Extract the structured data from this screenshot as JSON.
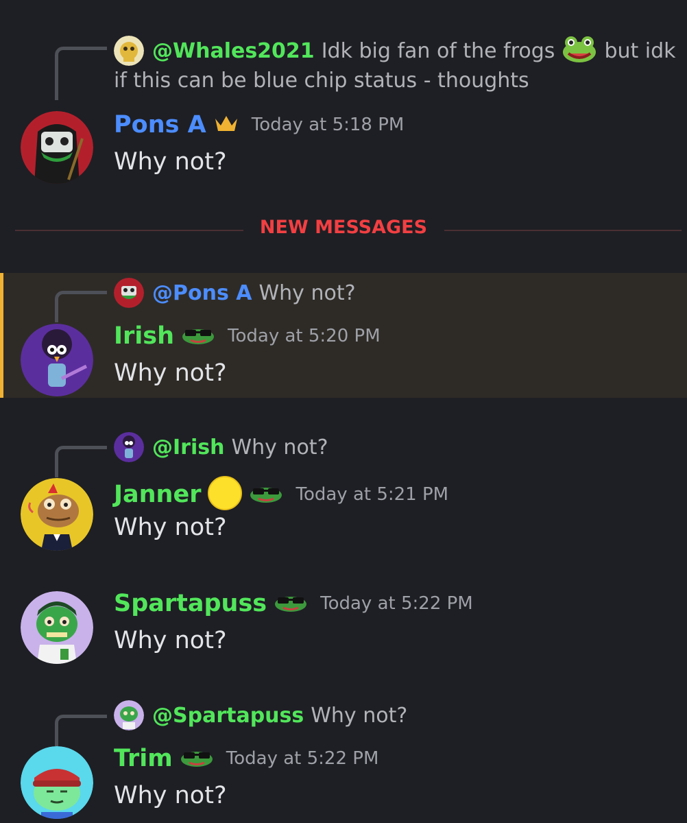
{
  "colors": {
    "background": "#1e1f24",
    "blue_name": "#4c8dff",
    "green_name": "#52e65b",
    "new_messages": "#f23f42",
    "highlight": "#2e2b27",
    "highlight_bar": "#f0b232"
  },
  "thread": [
    {
      "reply": {
        "avatar": "gold-frog-avatar",
        "name": "@Whales2021",
        "text": "Idk big fan of the frogs",
        "emoji": "frog-emoji",
        "text_after": "but idk",
        "text_line2": "if this can be blue chip status - thoughts"
      },
      "author": "Pons A",
      "badge": "crown-icon",
      "time": "Today at 5:18 PM",
      "message": "Why not?",
      "avatar": "red-masked-frog-avatar"
    },
    {
      "divider": "NEW MESSAGES"
    },
    {
      "reply": {
        "avatar": "red-masked-frog-avatar",
        "name": "@Pons A",
        "text": "Why not?"
      },
      "author": "Irish",
      "badge": "sunglasses-frog-icon",
      "time": "Today at 5:20 PM",
      "message": "Why not?",
      "avatar": "purple-bird-avatar"
    },
    {
      "reply": {
        "avatar": "purple-bird-avatar",
        "name": "@Irish",
        "text": "Why not?"
      },
      "author": "Janner",
      "badge": "yellow-circle-icon",
      "badge2": "sunglasses-frog-icon",
      "time": "Today at 5:21 PM",
      "message": "Why not?",
      "avatar": "yellow-frog-avatar"
    },
    {
      "author": "Spartapuss",
      "badge": "sunglasses-frog-icon",
      "time": "Today at 5:22 PM",
      "message": "Why not?",
      "avatar": "lavender-frog-avatar"
    },
    {
      "reply": {
        "avatar": "lavender-frog-avatar",
        "name": "@Spartapuss",
        "text": "Why not?"
      },
      "author": "Trim",
      "badge": "sunglasses-frog-icon",
      "time": "Today at 5:22 PM",
      "message": "Why not?",
      "avatar": "cyan-frog-avatar"
    }
  ]
}
